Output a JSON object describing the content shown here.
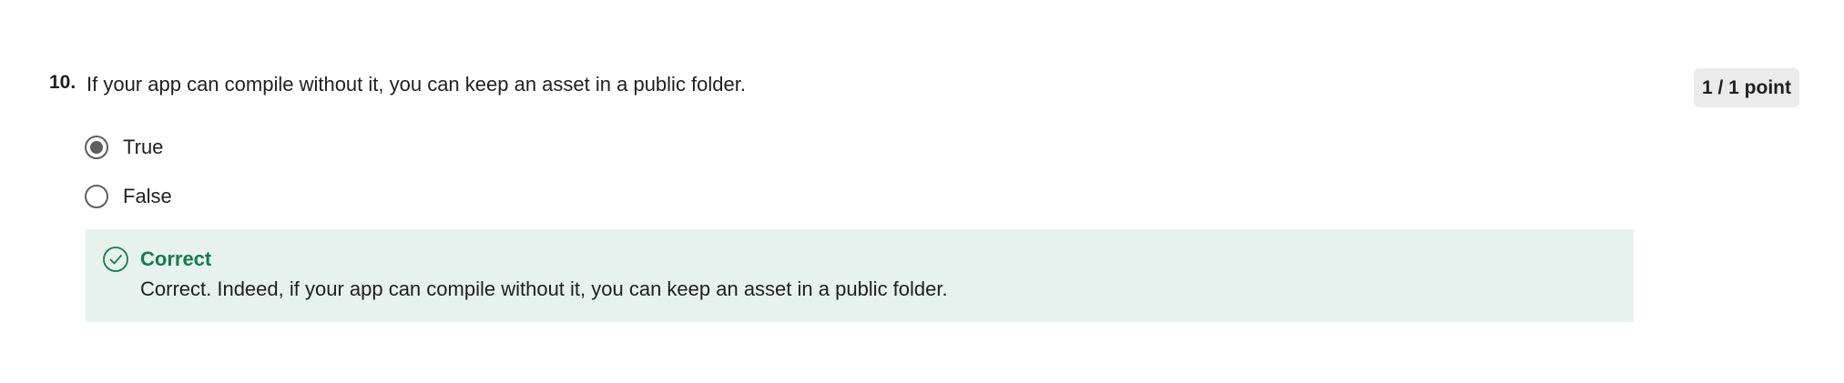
{
  "question": {
    "number": "10.",
    "text": "If your app can compile without it, you can keep an asset in a public folder.",
    "points": "1 / 1 point",
    "options": [
      {
        "label": "True",
        "selected": true
      },
      {
        "label": "False",
        "selected": false
      }
    ],
    "feedback": {
      "status": "Correct",
      "message": "Correct. Indeed, if your app can compile without it, you can keep an asset in a public folder.",
      "icon": "check-circle-icon",
      "color": "#137d4a",
      "background": "#e7f1ee"
    }
  }
}
